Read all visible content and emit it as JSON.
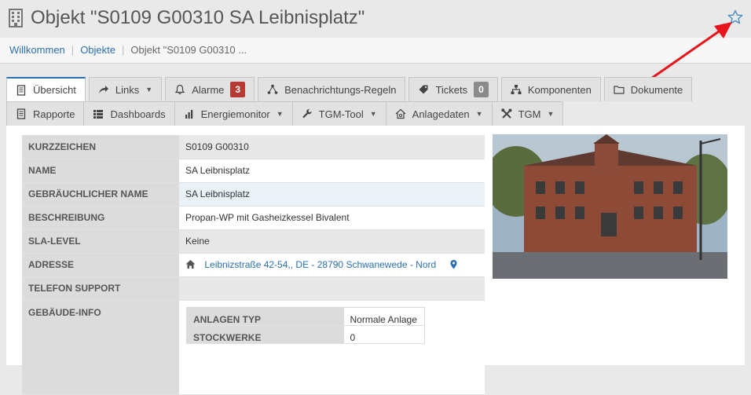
{
  "header": {
    "title": "Objekt \"S0109 G00310 SA Leibnisplatz\"",
    "title_icon": "building-icon",
    "favorite_icon": "star-outline-icon"
  },
  "breadcrumb": {
    "items": [
      "Willkommen",
      "Objekte"
    ],
    "current": "Objekt \"S0109 G00310 ..."
  },
  "tabs_row1": [
    {
      "label": "Übersicht",
      "icon": "document-icon",
      "active": true
    },
    {
      "label": "Links",
      "icon": "share-icon",
      "dropdown": true
    },
    {
      "label": "Alarme",
      "icon": "bell-icon",
      "badge": "3"
    },
    {
      "label": "Benachrichtungs-Regeln",
      "icon": "flow-icon"
    },
    {
      "label": "Tickets",
      "icon": "ticket-icon",
      "badge": "0"
    },
    {
      "label": "Komponenten",
      "icon": "sitemap-icon"
    },
    {
      "label": "Dokumente",
      "icon": "folder-icon"
    }
  ],
  "tabs_row2": [
    {
      "label": "Rapporte",
      "icon": "document-icon"
    },
    {
      "label": "Dashboards",
      "icon": "grid-icon"
    },
    {
      "label": "Energiemonitor",
      "icon": "bar-chart-icon",
      "dropdown": true
    },
    {
      "label": "TGM-Tool",
      "icon": "wrench-icon",
      "dropdown": true
    },
    {
      "label": "Anlagedaten",
      "icon": "home-settings-icon",
      "dropdown": true
    },
    {
      "label": "TGM",
      "icon": "tools-icon",
      "dropdown": true
    }
  ],
  "info": {
    "kurzzeichen": {
      "label": "Kurzzeichen",
      "value": "S0109 G00310"
    },
    "name": {
      "label": "Name",
      "value": "SA Leibnisplatz"
    },
    "gebr_name": {
      "label": "Gebräuchlicher Name",
      "value": "SA Leibnisplatz"
    },
    "beschreibung": {
      "label": "Beschreibung",
      "value": "Propan-WP mit Gasheizkessel Bivalent"
    },
    "sla": {
      "label": "SLA-Level",
      "value": "Keine"
    },
    "adresse": {
      "label": "Adresse",
      "value": "Leibnizstraße 42-54,, DE - 28790 Schwanewede - Nord"
    },
    "telefon": {
      "label": "Telefon Support",
      "value": ""
    },
    "gebaeude": {
      "label": "Gebäude-Info"
    }
  },
  "gebaeude_info": {
    "anlagen_typ": {
      "label": "Anlagen Typ",
      "value": "Normale Anlage"
    },
    "stockwerke": {
      "label": "Stockwerke",
      "value": "0"
    }
  },
  "colors": {
    "accent": "#2a6fb0",
    "badge_red": "#b73a35",
    "badge_grey": "#8b8b8b",
    "annotation_arrow": "#e8141b"
  }
}
